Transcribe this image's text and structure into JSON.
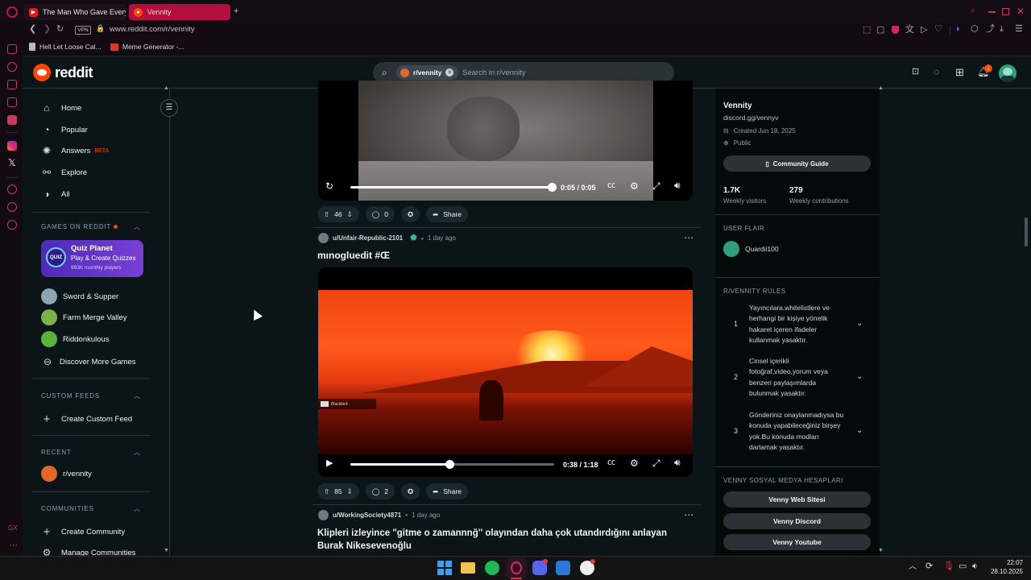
{
  "browser": {
    "tabs": [
      {
        "title": "The Man Who Gave Every",
        "active": false
      },
      {
        "title": "Vennity",
        "active": true
      }
    ],
    "new_tab_icon": "plus-icon",
    "url": "www.reddit.com/r/vennity",
    "vpn_label": "VPN",
    "bookmarks": [
      {
        "label": "Hell Let Loose Cal..."
      },
      {
        "label": "Meme Generator -..."
      }
    ],
    "accent_color": "#c0144a"
  },
  "reddit": {
    "logo_text": "reddit",
    "search": {
      "community_chip": "r/vennity",
      "placeholder": "Search in r/vennity"
    },
    "notification_count": "1",
    "brand_color": "#ff4500"
  },
  "left_nav": {
    "items": [
      {
        "label": "Home",
        "icon": "home-icon"
      },
      {
        "label": "Popular",
        "icon": "popular-icon"
      },
      {
        "label": "Answers",
        "icon": "answers-icon",
        "badge": "BETA"
      },
      {
        "label": "Explore",
        "icon": "explore-icon"
      },
      {
        "label": "All",
        "icon": "all-icon"
      }
    ],
    "games_header": "GAMES ON REDDIT",
    "promo": {
      "title": "Quiz Planet",
      "subtitle": "Play & Create Quizzes",
      "players": "993K monthly players",
      "icon_text": "QUIZ"
    },
    "games": [
      {
        "label": "Sword & Supper"
      },
      {
        "label": "Farm Merge Valley"
      },
      {
        "label": "Riddonkulous"
      },
      {
        "label": "Discover More Games"
      }
    ],
    "custom_feeds_header": "CUSTOM FEEDS",
    "create_custom_feed": "Create Custom Feed",
    "recent_header": "RECENT",
    "recent_item": "r/vennity",
    "communities_header": "COMMUNITIES",
    "create_community": "Create Community",
    "manage_communities": "Manage Communities"
  },
  "feed": {
    "post1": {
      "time_display": "0:05 / 0:05",
      "progress": 1.0,
      "votes": "46",
      "comments": "0",
      "share_label": "Share"
    },
    "post2": {
      "author": "u/Unfair-Republic-2101",
      "time": "1 day ago",
      "title": "mınogluedit #Œ",
      "time_display": "0:38 / 1:18",
      "progress": 0.487,
      "votes": "85",
      "comments": "2",
      "share_label": "Share",
      "overlay_text": "Blackbird"
    },
    "post3": {
      "author": "u/WorkingSociety4871",
      "time": "1 day ago",
      "title": "Klipleri izleyince ''gitme o zamannnğ'' olayından daha çok utandırdığını anlayan Burak Nikesevenoğlu"
    }
  },
  "right_sidebar": {
    "name": "Vennity",
    "discord": "discord.gg/vennyv",
    "created": "Created Jun 18, 2025",
    "visibility": "Public",
    "guide_button": "Community Guide",
    "stats": [
      {
        "value": "1.7K",
        "label": "Weekly visitors"
      },
      {
        "value": "279",
        "label": "Weekly contributions"
      }
    ],
    "user_flair_header": "USER FLAIR",
    "user_flair_name": "Quardii100",
    "rules_header": "R/VENNITY RULES",
    "rules": [
      {
        "num": "1",
        "text": "Yayıncılara,whitelistlere ve herhangi bir kişiye yönelik hakaret içeren ifadeler kullanmak yasaktır."
      },
      {
        "num": "2",
        "text": "Cinsel içerikli fotoğraf,video,yorum veya benzeri paylaşımlarda bulunmak yasaktır."
      },
      {
        "num": "3",
        "text": "Gönderiniz onaylanmadıysa bu konuda yapabileceğiniz birşey yok.Bu konuda modları darlamak yasaktır."
      }
    ],
    "social_header": "VENNY SOSYAL MEDYA HESAPLARI",
    "social_buttons": [
      "Venny Web Sitesi",
      "Venny Discord",
      "Venny Youtube"
    ]
  },
  "taskbar": {
    "time": "22:07",
    "date": "28.10.2025",
    "apps": [
      "windows-icon",
      "file-explorer-icon",
      "spotify-icon",
      "opera-gx-icon",
      "discord-icon",
      "app-icon",
      "steam-icon"
    ]
  }
}
